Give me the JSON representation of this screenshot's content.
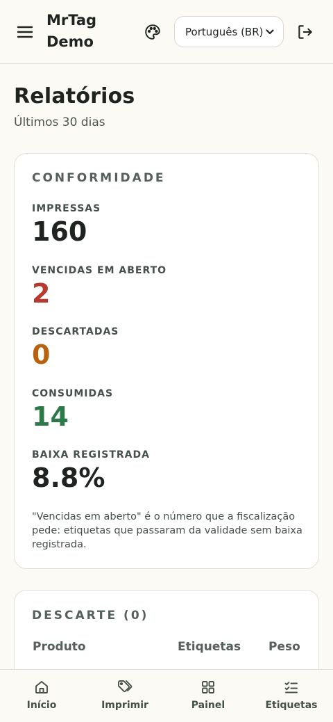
{
  "header": {
    "brand": "MrTag Demo",
    "language": "Português (BR)",
    "icons": [
      "menu-icon",
      "palette-icon",
      "chevron-down-icon",
      "logout-icon"
    ]
  },
  "page": {
    "title": "Relatórios",
    "subtitle": "Últimos 30 dias"
  },
  "compliance": {
    "heading": "CONFORMIDADE",
    "metrics": [
      {
        "label": "IMPRESSAS",
        "value": "160",
        "color": "#1f2421"
      },
      {
        "label": "VENCIDAS EM ABERTO",
        "value": "2",
        "color": "#b83a2f"
      },
      {
        "label": "DESCARTADAS",
        "value": "0",
        "color": "#b8620f"
      },
      {
        "label": "CONSUMIDAS",
        "value": "14",
        "color": "#2c7a4a"
      },
      {
        "label": "BAIXA REGISTRADA",
        "value": "8.8%",
        "color": "#1f2421"
      }
    ],
    "note": "\"Vencidas em aberto\" é o número que a fiscalização pede: etiquetas que passaram da validade sem baixa registrada."
  },
  "discard": {
    "heading": "DESCARTE (0)",
    "columns": [
      "Produto",
      "Etiquetas",
      "Peso"
    ]
  },
  "nav": {
    "items": [
      {
        "label": "Início",
        "icon": "home-icon"
      },
      {
        "label": "Imprimir",
        "icon": "tags-icon"
      },
      {
        "label": "Painel",
        "icon": "grid-icon"
      },
      {
        "label": "Etiquetas",
        "icon": "checklist-icon"
      }
    ]
  },
  "colors": {
    "background": "#fbfaf4",
    "card": "#ffffff",
    "border": "#e2e0d8",
    "danger": "#b83a2f",
    "warning": "#b8620f",
    "success": "#2c7a4a"
  }
}
